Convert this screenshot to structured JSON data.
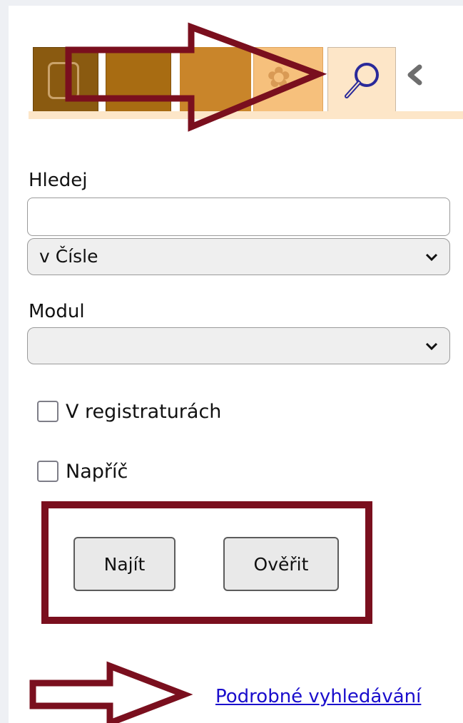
{
  "tabs": [
    {
      "name": "tab-1"
    },
    {
      "name": "tab-2"
    },
    {
      "name": "tab-3"
    },
    {
      "name": "tab-4"
    },
    {
      "name": "search",
      "active": true,
      "icon": "search-icon"
    }
  ],
  "colors": {
    "tab_active_bg": "#fde6c8",
    "annotation": "#7a0f1e",
    "link": "#1a0dcc"
  },
  "form": {
    "search_label": "Hledej",
    "search_value": "",
    "search_in_selected": "v Čísle",
    "module_label": "Modul",
    "module_selected": "",
    "checkbox_registratury": {
      "label": "V registraturách",
      "checked": false
    },
    "checkbox_naprice": {
      "label": "Napříč",
      "checked": false
    },
    "find_button": "Najít",
    "verify_button": "Ověřit"
  },
  "advanced_search_link": "Podrobné vyhledávání"
}
